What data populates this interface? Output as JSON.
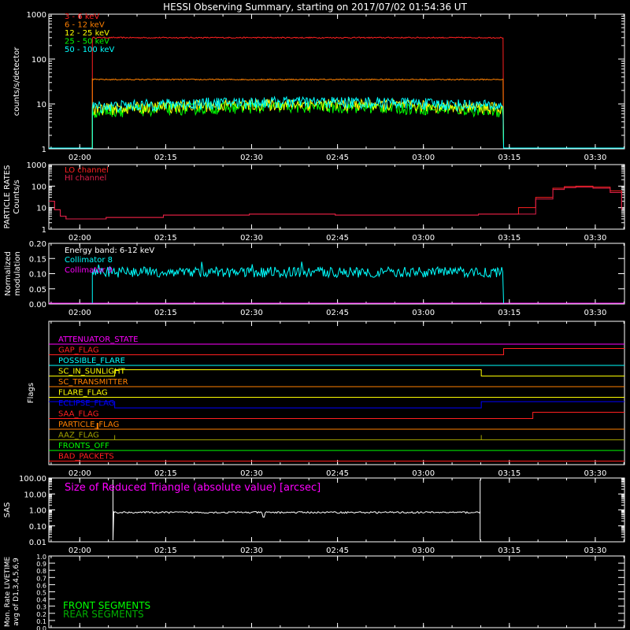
{
  "title": "HESSI Observing Summary, starting on 2017/07/02 01:54:36 UT",
  "time_ticks": [
    "02:00",
    "02:15",
    "02:30",
    "02:45",
    "03:00",
    "03:15",
    "03:30"
  ],
  "time_tick_minutes": [
    5.4,
    20.4,
    35.4,
    50.4,
    65.4,
    80.4,
    95.4
  ],
  "colors": {
    "red": "#ff2020",
    "orange": "#ff8000",
    "yellow": "#ffff00",
    "green": "#00ff00",
    "cyan": "#00ffff",
    "magenta": "#ff00ff",
    "blue": "#0000ff",
    "white": "#ffffff",
    "darkgreen": "#00b000",
    "olive": "#a0a000",
    "crimson": "#e0204a"
  },
  "chart_data": [
    {
      "type": "line",
      "name": "count-rates",
      "ylabel": "counts/s/detector",
      "yscale": "log",
      "ylim": [
        1,
        1000
      ],
      "ytick_labels": [
        "1",
        "10",
        "100",
        "1000"
      ],
      "legend": [
        "3 - 6 keV",
        "6 - 12 keV",
        "12 - 25 keV",
        "25 - 50 keV",
        "50 - 100 keV"
      ],
      "observation_window_minutes": [
        7.6,
        79.4
      ],
      "series": [
        {
          "name": "3 - 6 keV",
          "level": 300
        },
        {
          "name": "6 - 12 keV",
          "level": 35
        },
        {
          "name": "12 - 25 keV",
          "level": 8
        },
        {
          "name": "25 - 50 keV",
          "level": 7
        },
        {
          "name": "50 - 100 keV",
          "level": 9
        }
      ]
    },
    {
      "type": "line",
      "name": "particle-rates",
      "ylabel_lines": [
        "PARTICLE RATES",
        "Counts/s"
      ],
      "yscale": "log",
      "ylim": [
        1,
        1000
      ],
      "ytick_labels": [
        "1",
        "10",
        "100",
        "1000"
      ],
      "legend": [
        "LO channel",
        "HI channel"
      ],
      "series": [
        {
          "name": "LO channel",
          "x": [
            0,
            1,
            2,
            3,
            5,
            10,
            20,
            35,
            50,
            65,
            75,
            82,
            85,
            88,
            90,
            92,
            95,
            98,
            100
          ],
          "y": [
            20,
            8,
            4,
            3,
            3,
            3.5,
            4.5,
            5,
            4.5,
            4.5,
            5,
            10,
            30,
            80,
            95,
            100,
            90,
            60,
            10
          ]
        },
        {
          "name": "HI channel",
          "x": [
            0,
            1,
            2,
            3,
            5,
            10,
            20,
            35,
            50,
            65,
            75,
            82,
            85,
            88,
            90,
            92,
            95,
            98,
            100
          ],
          "y": [
            20,
            8,
            4,
            3,
            3,
            3.5,
            4.5,
            5,
            4.5,
            4.5,
            5,
            5,
            25,
            70,
            85,
            90,
            80,
            50,
            8
          ]
        }
      ]
    },
    {
      "type": "line",
      "name": "modulation",
      "ylabel_lines": [
        "Normalized",
        "modulation"
      ],
      "ylim": [
        0,
        0.2
      ],
      "ytick_labels": [
        "0.00",
        "0.05",
        "0.10",
        "0.15",
        "0.20"
      ],
      "annotation": "Energy band: 6-12 keV",
      "legend": [
        "Collimator 8",
        "Collimator 9"
      ],
      "window_minutes": [
        7.6,
        79.4
      ],
      "series": [
        {
          "name": "Collimator 8",
          "mean": 0.105
        },
        {
          "name": "Collimator 9",
          "mean": 0.0
        }
      ]
    },
    {
      "type": "line",
      "name": "flags",
      "ylabel": "Flags",
      "flags": [
        {
          "label": "ATTENUATOR_STATE",
          "color": "#ff00ff",
          "steps": []
        },
        {
          "label": "GAP_FLAG",
          "color": "#ff2020",
          "steps": [
            [
              79.4,
              1
            ]
          ]
        },
        {
          "label": "POSSIBLE_FLARE",
          "color": "#00ffff",
          "steps": []
        },
        {
          "label": "SC_IN_SUNLIGHT",
          "color": "#ffff00",
          "steps": [
            [
              11.5,
              1
            ],
            [
              75.5,
              0
            ]
          ]
        },
        {
          "label": "SC_TRANSMITTER",
          "color": "#ff8000",
          "steps": []
        },
        {
          "label": "FLARE_FLAG",
          "color": "#ffff00",
          "steps": []
        },
        {
          "label": "ECLIPSE_FLAG",
          "color": "#0000ff",
          "steps": [
            [
              0,
              1
            ],
            [
              11.5,
              0
            ],
            [
              75.5,
              1
            ]
          ]
        },
        {
          "label": "SAA_FLAG",
          "color": "#ff2020",
          "steps": [
            [
              84.5,
              1
            ]
          ]
        },
        {
          "label": "PARTICLE_FLAG",
          "color": "#ff8000",
          "steps": []
        },
        {
          "label": "AAZ_FLAG",
          "color": "#a0a000",
          "steps": []
        },
        {
          "label": "FRONTS_OFF",
          "color": "#00ff00",
          "steps": []
        },
        {
          "label": "BAD_PACKETS",
          "color": "#ff2020",
          "steps": []
        }
      ]
    },
    {
      "type": "line",
      "name": "sas",
      "ylabel": "SAS",
      "yscale": "log",
      "ylim": [
        0.01,
        100
      ],
      "ytick_labels": [
        "0.01",
        "0.10",
        "1.00",
        "10.00",
        "100.00"
      ],
      "annotation": "Size of Reduced Triangle (absolute value) [arcsec]",
      "window_minutes": [
        11.2,
        75.3
      ],
      "series": [
        {
          "name": "",
          "level": 0.7
        }
      ]
    },
    {
      "type": "line",
      "name": "livetime",
      "ylabel_lines": [
        "Mon. Rate LIVETIME",
        "avg of D1,3,4,5,6,9"
      ],
      "ylim": [
        0,
        1
      ],
      "ytick_labels": [
        "0.0",
        "0.1",
        "0.2",
        "0.3",
        "0.4",
        "0.5",
        "0.6",
        "0.7",
        "0.8",
        "0.9",
        "1.0"
      ],
      "legend": [
        "FRONT SEGMENTS",
        "REAR SEGMENTS"
      ],
      "series": []
    }
  ]
}
